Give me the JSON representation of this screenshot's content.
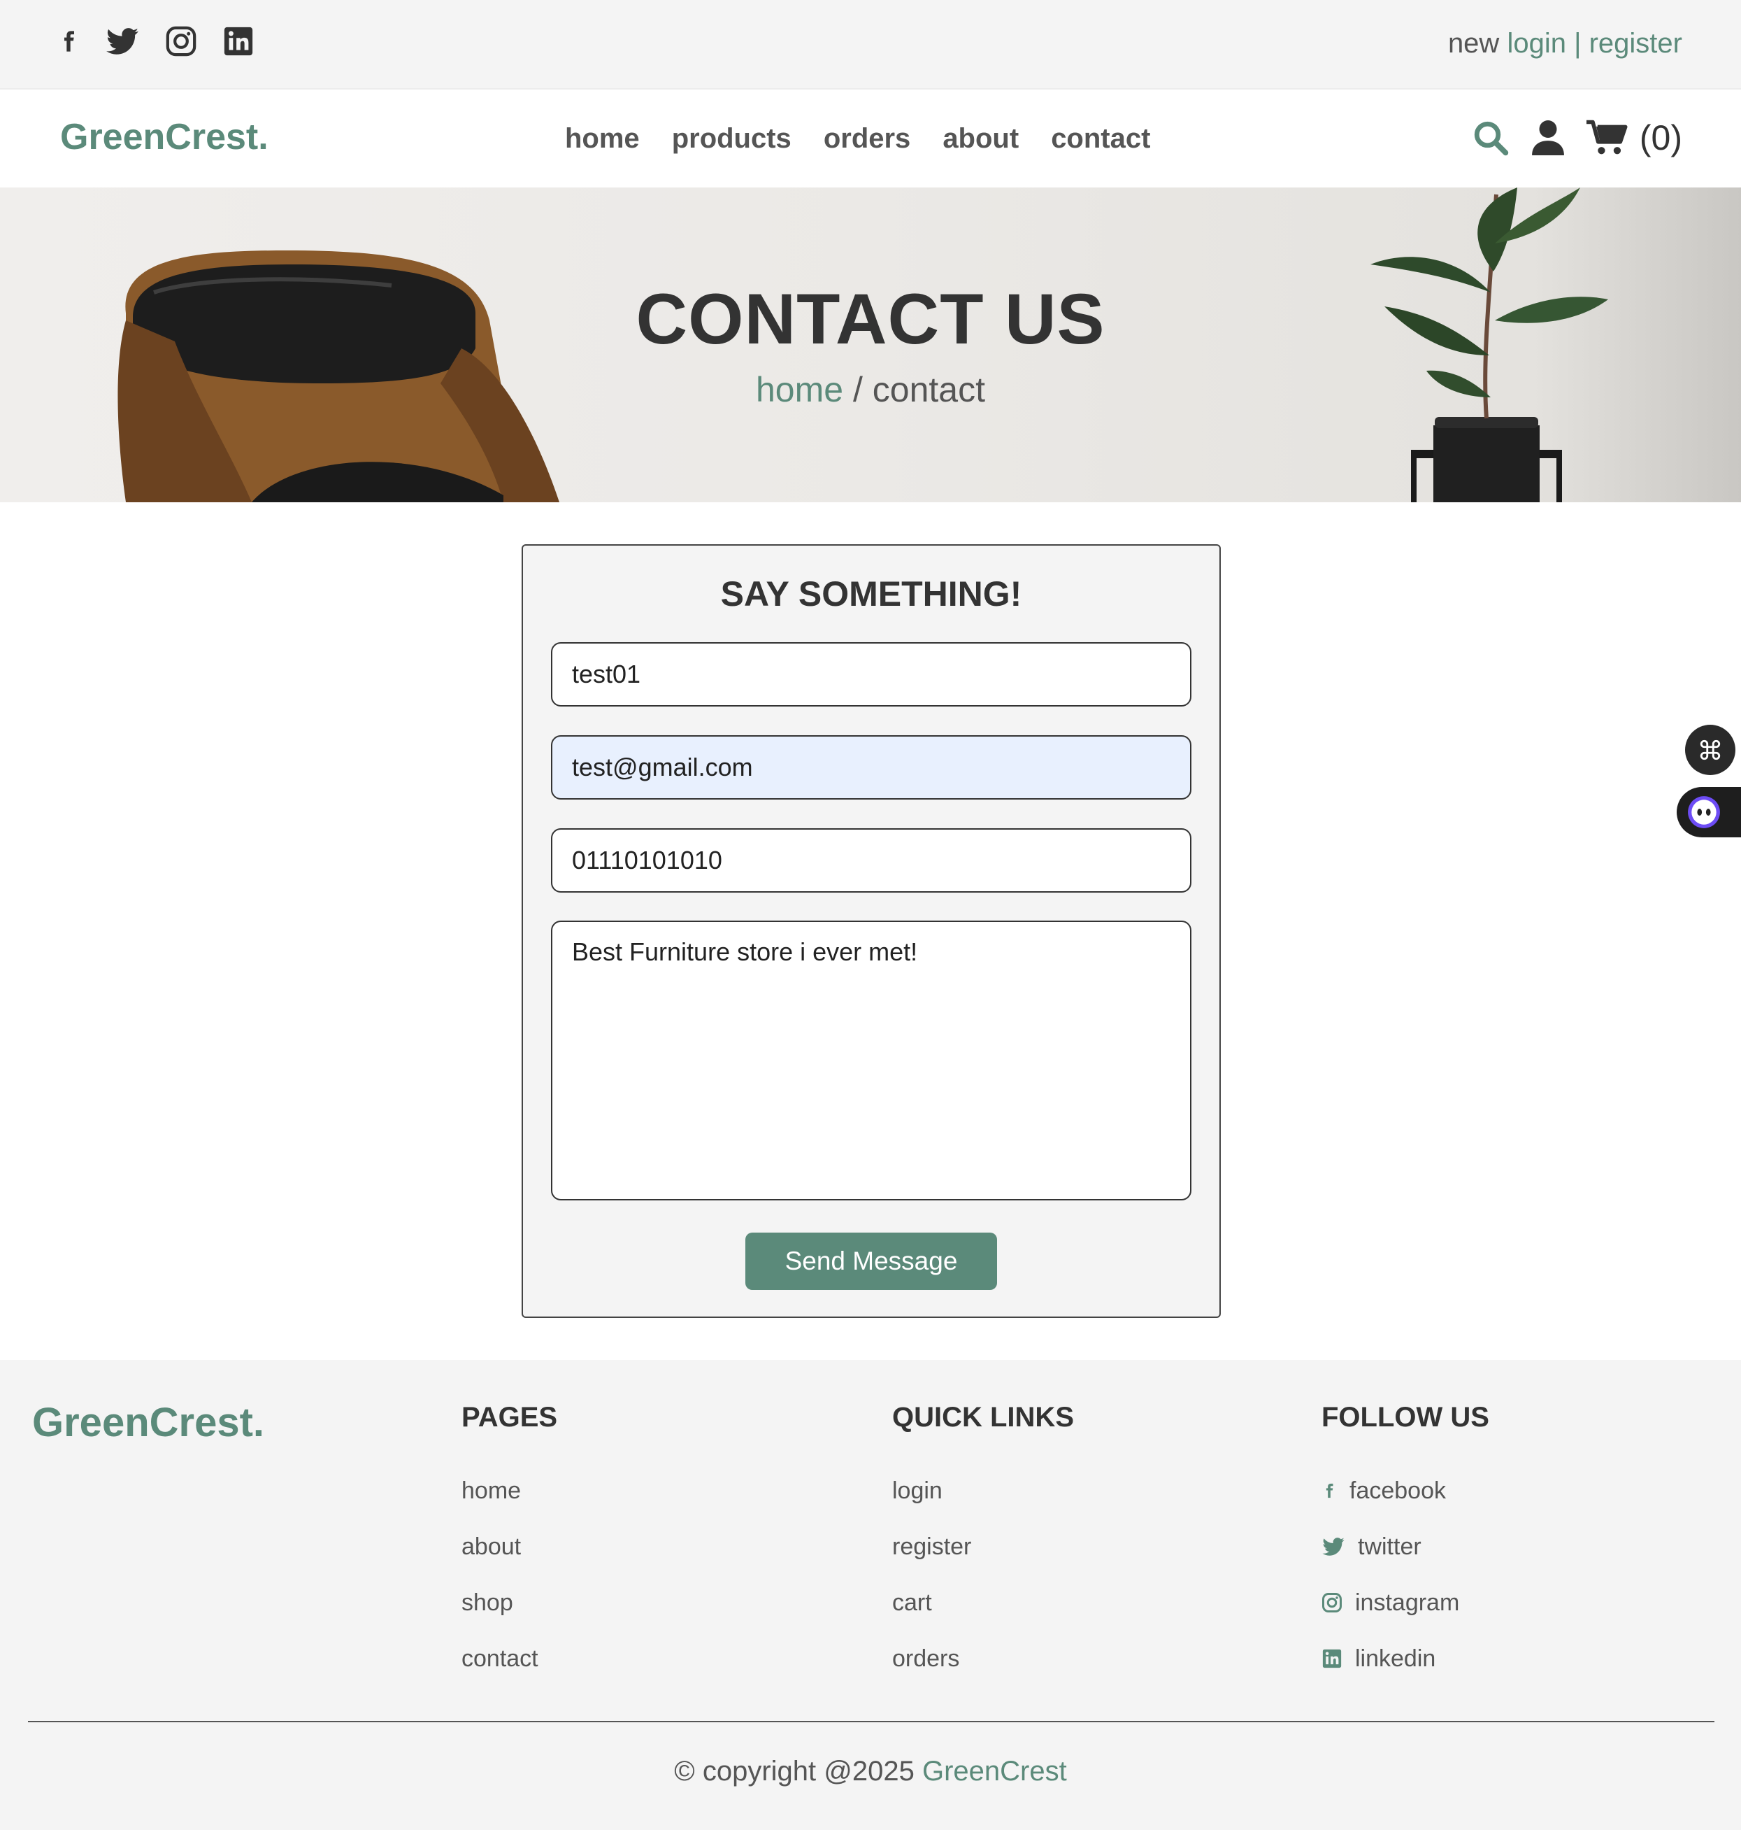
{
  "colors": {
    "accent": "#5b8a7a",
    "text": "#333333",
    "topbar_bg": "#f4f4f4",
    "autofill_bg": "#e8f0fe"
  },
  "topbar": {
    "social_icons": [
      "facebook-icon",
      "twitter-icon",
      "instagram-icon",
      "linkedin-icon"
    ],
    "auth_prefix": "new",
    "login": "login",
    "separator": "|",
    "register": "register"
  },
  "header": {
    "logo": "GreenCrest.",
    "nav": [
      "home",
      "products",
      "orders",
      "about",
      "contact"
    ],
    "icons": [
      "search-icon",
      "user-icon",
      "cart-icon"
    ],
    "cart_count": "(0)"
  },
  "hero": {
    "title": "CONTACT US",
    "crumb_home": "home",
    "crumb_sep": " / ",
    "crumb_current": "contact"
  },
  "form": {
    "title": "SAY SOMETHING!",
    "name_value": "test01",
    "email_value": "test@gmail.com",
    "phone_value": "01110101010",
    "message_value": "Best Furniture store i ever met!",
    "send_label": "Send Message"
  },
  "footer": {
    "logo": "GreenCrest.",
    "pages_title": "PAGES",
    "pages": [
      "home",
      "about",
      "shop",
      "contact"
    ],
    "quick_title": "QUICK LINKS",
    "quick": [
      "login",
      "register",
      "cart",
      "orders"
    ],
    "follow_title": "FOLLOW US",
    "follow": [
      "facebook",
      "twitter",
      "instagram",
      "linkedin"
    ],
    "copyright_prefix": "© copyright @2025",
    "copyright_brand": "GreenCrest"
  }
}
